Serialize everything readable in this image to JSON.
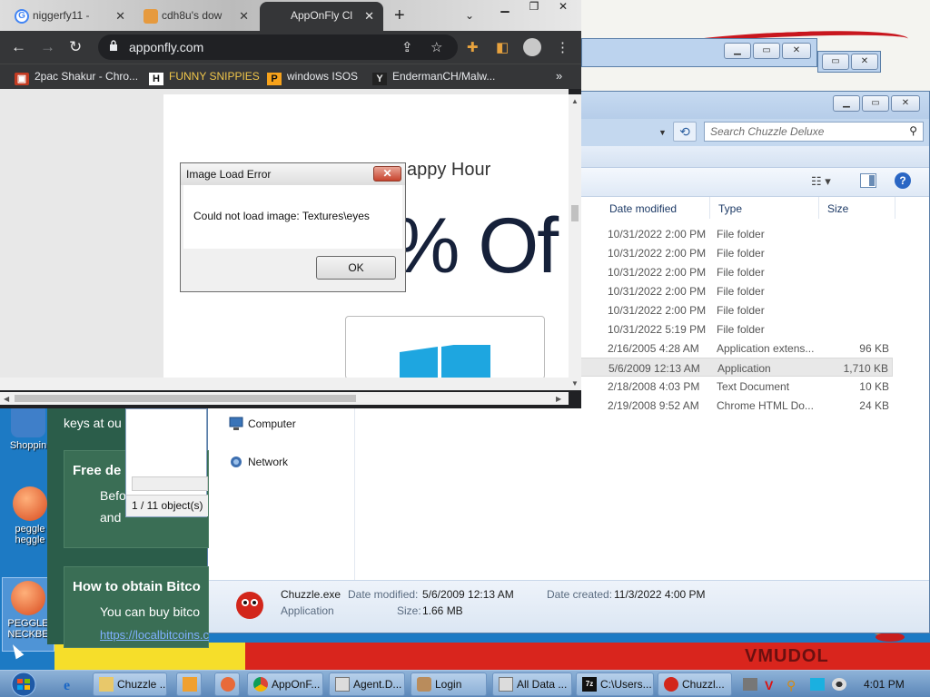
{
  "desktop": {
    "icons": [
      {
        "label": "Shoppin"
      },
      {
        "label": "peggle heggle"
      },
      {
        "label": "PEGGLE NECKBE"
      }
    ],
    "wall_text": "VMUDOL"
  },
  "chrome": {
    "tabs": [
      {
        "label": "niggerfy11 - ",
        "active": false
      },
      {
        "label": "cdh8u's dow",
        "active": false
      },
      {
        "label": "AppOnFly Cl",
        "active": true
      }
    ],
    "url": "apponfly.com",
    "bookmarks": [
      {
        "label": "2pac Shakur - Chro...",
        "icon": "H-red"
      },
      {
        "label": "FUNNY SNIPPIES",
        "icon": "H"
      },
      {
        "label": "windows ISOS",
        "icon": "PH"
      },
      {
        "label": "EndermanCH/Malw...",
        "icon": "YP"
      }
    ],
    "page": {
      "happy_hour": "appy Hour",
      "discount": "% Of"
    }
  },
  "dialog": {
    "title": "Image Load Error",
    "message": "Could not load image: Textures\\eyes",
    "ok_label": "OK"
  },
  "explorer": {
    "search_placeholder": "Search Chuzzle Deluxe",
    "columns": {
      "date": "Date modified",
      "type": "Type",
      "size": "Size"
    },
    "rows": [
      {
        "date": "10/31/2022 2:00 PM",
        "type": "File folder",
        "size": ""
      },
      {
        "date": "10/31/2022 2:00 PM",
        "type": "File folder",
        "size": ""
      },
      {
        "date": "10/31/2022 2:00 PM",
        "type": "File folder",
        "size": ""
      },
      {
        "date": "10/31/2022 2:00 PM",
        "type": "File folder",
        "size": ""
      },
      {
        "date": "10/31/2022 2:00 PM",
        "type": "File folder",
        "size": ""
      },
      {
        "date": "10/31/2022 5:19 PM",
        "type": "File folder",
        "size": ""
      },
      {
        "date": "2/16/2005 4:28 AM",
        "type": "Application extens...",
        "size": "96 KB"
      },
      {
        "date": "5/6/2009 12:13 AM",
        "type": "Application",
        "size": "1,710 KB",
        "selected": true
      },
      {
        "date": "2/18/2008 4:03 PM",
        "type": "Text Document",
        "size": "10 KB"
      },
      {
        "date": "2/19/2008 9:52 AM",
        "type": "Chrome HTML Do...",
        "size": "24 KB"
      }
    ],
    "nav": [
      {
        "label": "Computer"
      },
      {
        "label": "Network"
      }
    ],
    "details": {
      "name": "Chuzzle.exe",
      "kind": "Application",
      "modified_label": "Date modified:",
      "modified": "5/6/2009 12:13 AM",
      "size_label": "Size:",
      "size": "1.66 MB",
      "created_label": "Date created:",
      "created": "11/3/2022 4:00 PM"
    }
  },
  "lower_window": {
    "status": "1 / 11 object(s)"
  },
  "web_behind": {
    "keys_text": "keys at ou",
    "free_heading": "Free de",
    "line1": "Befo",
    "line2": "and",
    "howto_heading": "How to obtain Bitco",
    "buy_text": "You can buy bitco",
    "link_text": "https://localbitcoins.com/"
  },
  "taskbar": {
    "buttons": [
      {
        "label": "Chuzzle ..."
      },
      {
        "label": "AppOnF..."
      },
      {
        "label": "Agent.D..."
      },
      {
        "label": "Login"
      },
      {
        "label": "All Data ..."
      },
      {
        "label": "C:\\Users..."
      },
      {
        "label": "Chuzzl..."
      }
    ],
    "clock": "4:01 PM"
  }
}
